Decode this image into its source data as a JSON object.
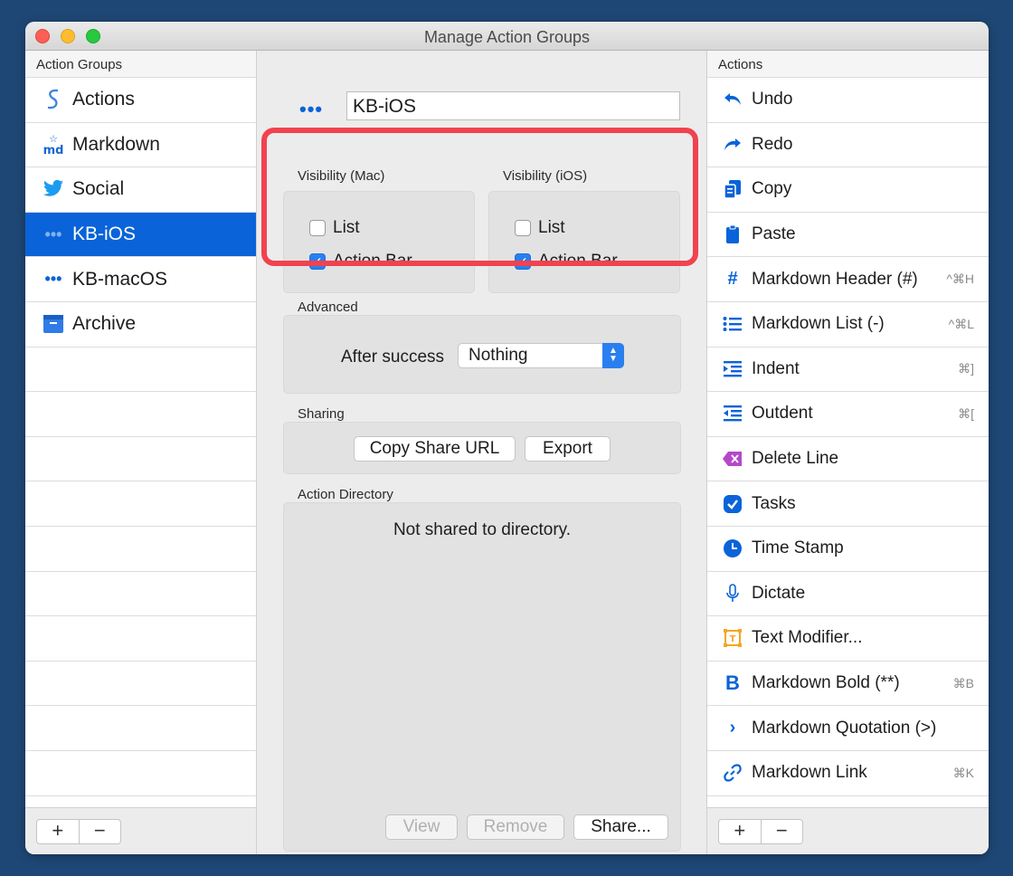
{
  "window": {
    "title": "Manage Action Groups"
  },
  "groups": {
    "header": "Action Groups",
    "items": [
      {
        "label": "Actions",
        "icon": "script-s-icon"
      },
      {
        "label": "Markdown",
        "icon": "markdown-icon"
      },
      {
        "label": "Social",
        "icon": "twitter-bird-icon"
      },
      {
        "label": "KB-iOS",
        "icon": "ellipsis-icon",
        "selected": true
      },
      {
        "label": "KB-macOS",
        "icon": "ellipsis-icon"
      },
      {
        "label": "Archive",
        "icon": "archive-box-icon"
      }
    ]
  },
  "editor": {
    "name_value": "KB-iOS",
    "visibility_mac": {
      "label": "Visibility (Mac)",
      "list": "List",
      "list_checked": false,
      "action_bar": "Action Bar",
      "action_bar_checked": true
    },
    "visibility_ios": {
      "label": "Visibility (iOS)",
      "list": "List",
      "list_checked": false,
      "action_bar": "Action Bar",
      "action_bar_checked": true
    },
    "advanced": {
      "label": "Advanced",
      "after_success_label": "After success",
      "after_success_value": "Nothing"
    },
    "sharing": {
      "label": "Sharing",
      "copy_url": "Copy Share URL",
      "export": "Export"
    },
    "directory": {
      "label": "Action Directory",
      "status": "Not shared to directory.",
      "view": "View",
      "remove": "Remove",
      "share": "Share..."
    }
  },
  "actions": {
    "header": "Actions",
    "items": [
      {
        "label": "Undo",
        "shortcut": "",
        "icon": "undo-icon"
      },
      {
        "label": "Redo",
        "shortcut": "",
        "icon": "redo-icon"
      },
      {
        "label": "Copy",
        "shortcut": "",
        "icon": "copy-icon"
      },
      {
        "label": "Paste",
        "shortcut": "",
        "icon": "paste-icon"
      },
      {
        "label": "Markdown Header (#)",
        "shortcut": "^⌘H",
        "icon": "hash-icon"
      },
      {
        "label": "Markdown List (-)",
        "shortcut": "^⌘L",
        "icon": "list-icon"
      },
      {
        "label": "Indent",
        "shortcut": "⌘]",
        "icon": "indent-icon"
      },
      {
        "label": "Outdent",
        "shortcut": "⌘[",
        "icon": "outdent-icon"
      },
      {
        "label": "Delete Line",
        "shortcut": "",
        "icon": "delete-line-icon"
      },
      {
        "label": "Tasks",
        "shortcut": "",
        "icon": "checkmark-circle-icon"
      },
      {
        "label": "Time Stamp",
        "shortcut": "",
        "icon": "clock-icon"
      },
      {
        "label": "Dictate",
        "shortcut": "",
        "icon": "microphone-icon"
      },
      {
        "label": "Text Modifier...",
        "shortcut": "",
        "icon": "text-modifier-icon"
      },
      {
        "label": "Markdown Bold (**)",
        "shortcut": "⌘B",
        "icon": "bold-b-icon"
      },
      {
        "label": "Markdown Quotation (>)",
        "shortcut": "",
        "icon": "chevron-right-icon"
      },
      {
        "label": "Markdown Link",
        "shortcut": "⌘K",
        "icon": "link-icon"
      }
    ]
  },
  "controls": {
    "add": "+",
    "remove": "−"
  },
  "colors": {
    "accent": "#0a63d8",
    "highlight": "#f1424f",
    "background": "#1f4775"
  }
}
